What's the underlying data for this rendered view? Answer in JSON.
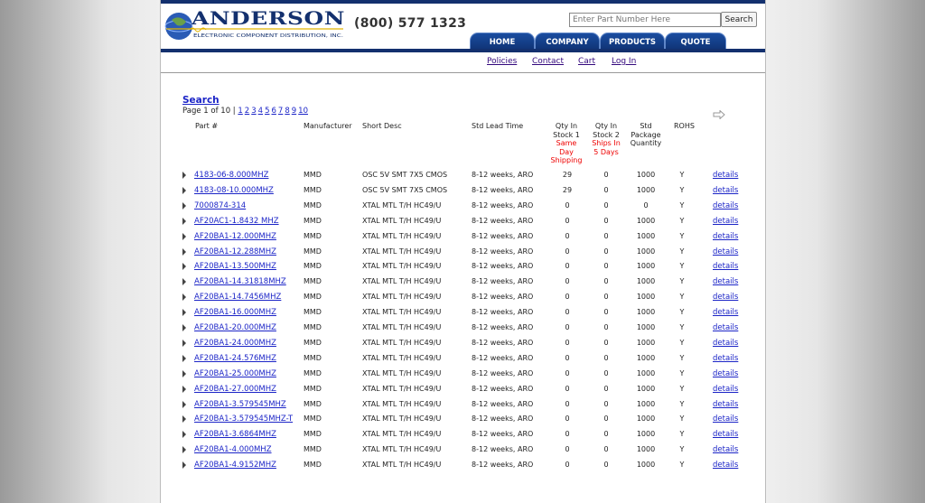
{
  "header": {
    "logo_name": "ANDERSON",
    "logo_tagline": "ELECTRONIC COMPONENT DISTRIBUTION, INC.",
    "phone": "(800) 577 1323",
    "search_placeholder": "Enter Part Number Here",
    "search_button": "Search",
    "brand_color": "#13306e"
  },
  "nav": {
    "tabs": [
      "HOME",
      "COMPANY",
      "PRODUCTS",
      "QUOTE"
    ],
    "links": [
      "Policies",
      "Contact",
      "Cart",
      "Log In"
    ]
  },
  "results": {
    "title": "Search",
    "page_text": "Page 1 of 10  |",
    "pages": [
      "1",
      "2",
      "3",
      "4",
      "5",
      "6",
      "7",
      "8",
      "9",
      "10"
    ],
    "columns": {
      "part": "Part #",
      "manufacturer": "Manufacturer",
      "short_desc": "Short Desc",
      "lead_time": "Std Lead Time",
      "qty1": [
        "Qty In",
        "Stock 1"
      ],
      "qty1_note": [
        "Same",
        "Day",
        "Shipping"
      ],
      "qty2": [
        "Qty In",
        "Stock 2"
      ],
      "qty2_note": [
        "Ships In",
        "5 Days"
      ],
      "pkg": [
        "Std",
        "Package",
        "Quantity"
      ],
      "rohs": "ROHS"
    },
    "rows": [
      {
        "part": "4183-06-8.000MHZ",
        "mfr": "MMD",
        "desc": "OSC 5V SMT 7X5 CMOS",
        "lead": "8-12 weeks, ARO",
        "q1": "29",
        "q2": "0",
        "pkg": "1000",
        "rohs": "Y",
        "details": "details"
      },
      {
        "part": "4183-08-10.000MHZ",
        "mfr": "MMD",
        "desc": "OSC 5V SMT 7X5 CMOS",
        "lead": "8-12 weeks, ARO",
        "q1": "29",
        "q2": "0",
        "pkg": "1000",
        "rohs": "Y",
        "details": "details"
      },
      {
        "part": "7000874-314",
        "mfr": "MMD",
        "desc": "XTAL MTL T/H HC49/U",
        "lead": "8-12 weeks, ARO",
        "q1": "0",
        "q2": "0",
        "pkg": "0",
        "rohs": "Y",
        "details": "details"
      },
      {
        "part": "AF20AC1-1.8432 MHZ",
        "mfr": "MMD",
        "desc": "XTAL MTL T/H HC49/U",
        "lead": "8-12 weeks, ARO",
        "q1": "0",
        "q2": "0",
        "pkg": "1000",
        "rohs": "Y",
        "details": "details"
      },
      {
        "part": "AF20BA1-12.000MHZ",
        "mfr": "MMD",
        "desc": "XTAL MTL T/H HC49/U",
        "lead": "8-12 weeks, ARO",
        "q1": "0",
        "q2": "0",
        "pkg": "1000",
        "rohs": "Y",
        "details": "details"
      },
      {
        "part": "AF20BA1-12.288MHZ",
        "mfr": "MMD",
        "desc": "XTAL MTL T/H HC49/U",
        "lead": "8-12 weeks, ARO",
        "q1": "0",
        "q2": "0",
        "pkg": "1000",
        "rohs": "Y",
        "details": "details"
      },
      {
        "part": "AF20BA1-13.500MHZ",
        "mfr": "MMD",
        "desc": "XTAL MTL T/H HC49/U",
        "lead": "8-12 weeks, ARO",
        "q1": "0",
        "q2": "0",
        "pkg": "1000",
        "rohs": "Y",
        "details": "details"
      },
      {
        "part": "AF20BA1-14.31818MHZ",
        "mfr": "MMD",
        "desc": "XTAL MTL T/H HC49/U",
        "lead": "8-12 weeks, ARO",
        "q1": "0",
        "q2": "0",
        "pkg": "1000",
        "rohs": "Y",
        "details": "details"
      },
      {
        "part": "AF20BA1-14.7456MHZ",
        "mfr": "MMD",
        "desc": "XTAL MTL T/H HC49/U",
        "lead": "8-12 weeks, ARO",
        "q1": "0",
        "q2": "0",
        "pkg": "1000",
        "rohs": "Y",
        "details": "details"
      },
      {
        "part": "AF20BA1-16.000MHZ",
        "mfr": "MMD",
        "desc": "XTAL MTL T/H HC49/U",
        "lead": "8-12 weeks, ARO",
        "q1": "0",
        "q2": "0",
        "pkg": "1000",
        "rohs": "Y",
        "details": "details"
      },
      {
        "part": "AF20BA1-20.000MHZ",
        "mfr": "MMD",
        "desc": "XTAL MTL T/H HC49/U",
        "lead": "8-12 weeks, ARO",
        "q1": "0",
        "q2": "0",
        "pkg": "1000",
        "rohs": "Y",
        "details": "details"
      },
      {
        "part": "AF20BA1-24.000MHZ",
        "mfr": "MMD",
        "desc": "XTAL MTL T/H HC49/U",
        "lead": "8-12 weeks, ARO",
        "q1": "0",
        "q2": "0",
        "pkg": "1000",
        "rohs": "Y",
        "details": "details"
      },
      {
        "part": "AF20BA1-24.576MHZ",
        "mfr": "MMD",
        "desc": "XTAL MTL T/H HC49/U",
        "lead": "8-12 weeks, ARO",
        "q1": "0",
        "q2": "0",
        "pkg": "1000",
        "rohs": "Y",
        "details": "details"
      },
      {
        "part": "AF20BA1-25.000MHZ",
        "mfr": "MMD",
        "desc": "XTAL MTL T/H HC49/U",
        "lead": "8-12 weeks, ARO",
        "q1": "0",
        "q2": "0",
        "pkg": "1000",
        "rohs": "Y",
        "details": "details"
      },
      {
        "part": "AF20BA1-27.000MHZ",
        "mfr": "MMD",
        "desc": "XTAL MTL T/H HC49/U",
        "lead": "8-12 weeks, ARO",
        "q1": "0",
        "q2": "0",
        "pkg": "1000",
        "rohs": "Y",
        "details": "details"
      },
      {
        "part": "AF20BA1-3.579545MHZ",
        "mfr": "MMD",
        "desc": "XTAL MTL T/H HC49/U",
        "lead": "8-12 weeks, ARO",
        "q1": "0",
        "q2": "0",
        "pkg": "1000",
        "rohs": "Y",
        "details": "details"
      },
      {
        "part": "AF20BA1-3.579545MHZ-T",
        "mfr": "MMD",
        "desc": "XTAL MTL T/H HC49/U",
        "lead": "8-12 weeks, ARO",
        "q1": "0",
        "q2": "0",
        "pkg": "1000",
        "rohs": "Y",
        "details": "details"
      },
      {
        "part": "AF20BA1-3.6864MHZ",
        "mfr": "MMD",
        "desc": "XTAL MTL T/H HC49/U",
        "lead": "8-12 weeks, ARO",
        "q1": "0",
        "q2": "0",
        "pkg": "1000",
        "rohs": "Y",
        "details": "details"
      },
      {
        "part": "AF20BA1-4.000MHZ",
        "mfr": "MMD",
        "desc": "XTAL MTL T/H HC49/U",
        "lead": "8-12 weeks, ARO",
        "q1": "0",
        "q2": "0",
        "pkg": "1000",
        "rohs": "Y",
        "details": "details"
      },
      {
        "part": "AF20BA1-4.9152MHZ",
        "mfr": "MMD",
        "desc": "XTAL MTL T/H HC49/U",
        "lead": "8-12 weeks, ARO",
        "q1": "0",
        "q2": "0",
        "pkg": "1000",
        "rohs": "Y",
        "details": "details"
      }
    ]
  }
}
